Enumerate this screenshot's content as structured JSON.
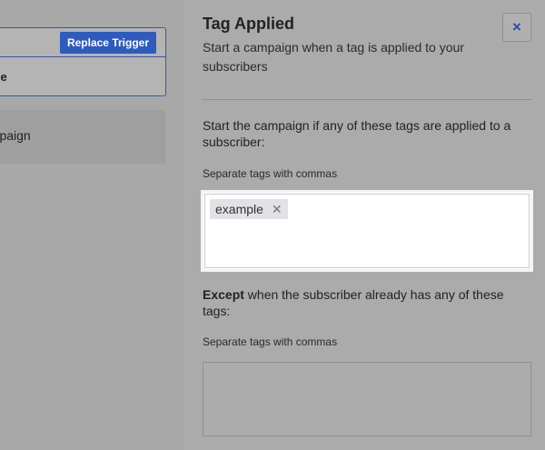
{
  "canvas": {
    "trigger": {
      "replace_label": "Replace Trigger",
      "name_fragment": "nple"
    },
    "action": {
      "label_fragment": "ampaign"
    }
  },
  "panel": {
    "title": "Tag Applied",
    "close_glyph": "×",
    "subtitle": "Start a campaign when a tag is applied to your subscribers",
    "include": {
      "question": "Start the campaign if any of these tags are applied to a subscriber:",
      "hint": "Separate tags with commas",
      "tags": [
        {
          "label": "example",
          "remove_glyph": "✕"
        }
      ]
    },
    "exclude": {
      "question_bold": "Except",
      "question_rest": " when the subscriber already has any of these tags:",
      "hint": "Separate tags with commas",
      "tags": []
    }
  },
  "colors": {
    "accent": "#2e5bbd",
    "overlay": "#a8a8a8"
  }
}
